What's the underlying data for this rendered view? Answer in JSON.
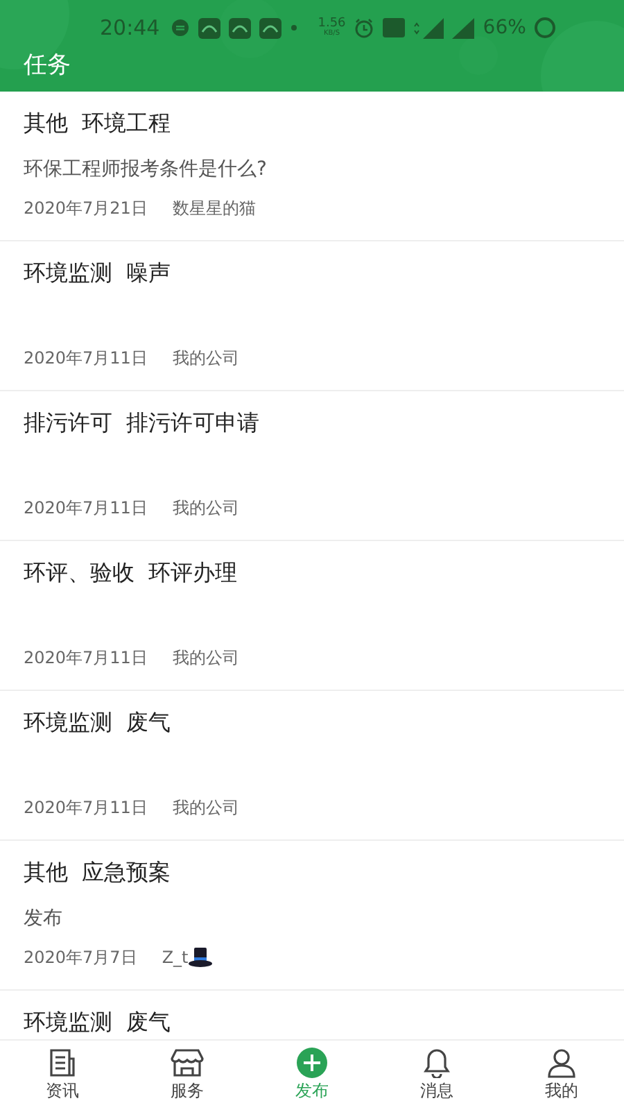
{
  "status_bar": {
    "time": "20:44",
    "net_speed": "1.56",
    "net_unit": "KB/S",
    "battery": "66%"
  },
  "header": {
    "title": "任务"
  },
  "tasks": [
    {
      "category": "其他",
      "topic": "环境工程",
      "description": "环保工程师报考条件是什么?",
      "date": "2020年7月21日",
      "author": "数星星的猫"
    },
    {
      "category": "环境监测",
      "topic": "噪声",
      "date": "2020年7月11日",
      "author": "我的公司"
    },
    {
      "category": "排污许可",
      "topic": "排污许可申请",
      "date": "2020年7月11日",
      "author": "我的公司"
    },
    {
      "category": "环评、验收",
      "topic": "环评办理",
      "date": "2020年7月11日",
      "author": "我的公司"
    },
    {
      "category": "环境监测",
      "topic": "废气",
      "date": "2020年7月11日",
      "author": "我的公司"
    },
    {
      "category": "其他",
      "topic": "应急预案",
      "description": "发布",
      "date": "2020年7月7日",
      "author": "Z_t",
      "kind": "hat"
    },
    {
      "category": "环境监测",
      "topic": "废气"
    }
  ],
  "bottom_nav": [
    {
      "label": "资讯",
      "kind": "news",
      "selected": false
    },
    {
      "label": "服务",
      "kind": "store",
      "selected": false
    },
    {
      "label": "发布",
      "kind": "add",
      "selected": true
    },
    {
      "label": "消息",
      "kind": "bell",
      "selected": false
    },
    {
      "label": "我的",
      "kind": "person",
      "selected": false
    }
  ]
}
